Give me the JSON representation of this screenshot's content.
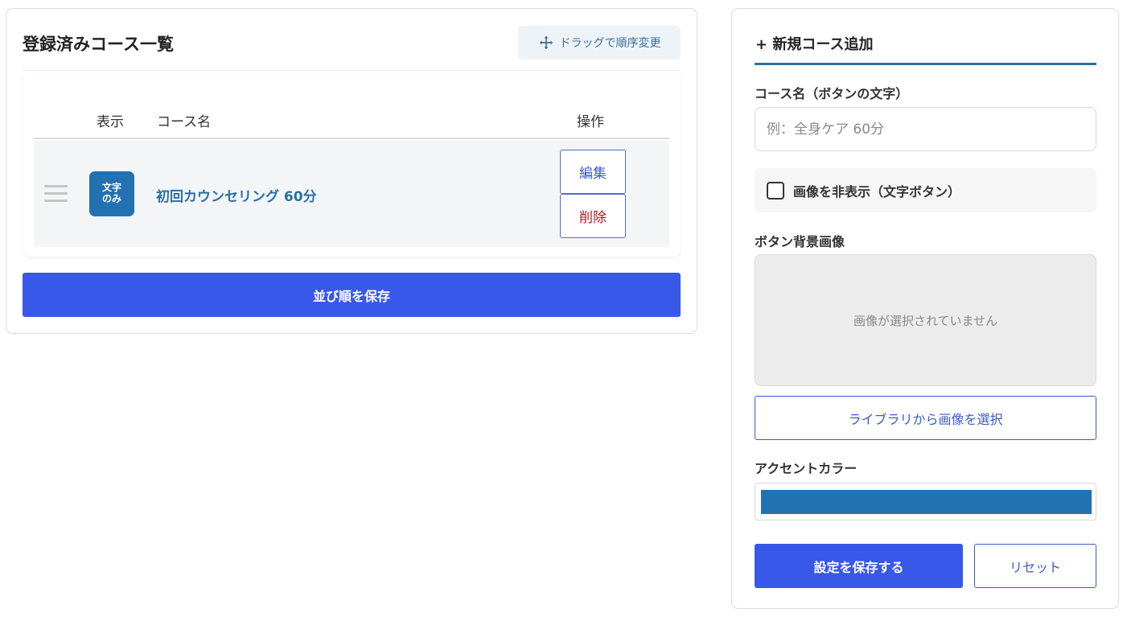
{
  "course_list": {
    "title": "登録済みコース一覧",
    "drag_hint": "ドラッグで順序変更",
    "drag_hint_icon": "move-arrows-icon",
    "columns": {
      "display": "表示",
      "name": "コース名",
      "operations": "操作"
    },
    "rows": [
      {
        "badge_line1": "文字",
        "badge_line2": "のみ",
        "badge_color": "#2271b1",
        "name": "初回カウンセリング 60分",
        "edit_label": "編集",
        "delete_label": "削除"
      }
    ],
    "save_order_label": "並び順を保存"
  },
  "add_course": {
    "title": "+ 新規コース追加",
    "name_label": "コース名（ボタンの文字）",
    "name_value": "",
    "name_placeholder": "例：全身ケア 60分",
    "hide_image_label": "画像を非表示（文字ボタン）",
    "hide_image_checked": false,
    "bg_image_label": "ボタン背景画像",
    "no_image_text": "画像が選択されていません",
    "select_from_library_label": "ライブラリから画像を選択",
    "accent_color_label": "アクセントカラー",
    "accent_color_value": "#2271b1",
    "save_label": "設定を保存する",
    "reset_label": "リセット"
  },
  "colors": {
    "primary": "#3858e9",
    "heading_accent": "#2d6f99",
    "danger": "#b01c1c"
  }
}
